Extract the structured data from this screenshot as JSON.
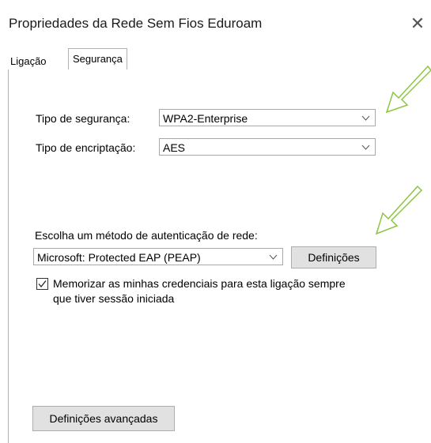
{
  "window": {
    "title": "Propriedades da Rede Sem Fios Eduroam",
    "close_glyph": "✕"
  },
  "tabs": [
    {
      "label": "Ligação",
      "active": false
    },
    {
      "label": "Segurança",
      "active": true
    }
  ],
  "security": {
    "type_label": "Tipo de segurança:",
    "type_value": "WPA2-Enterprise",
    "encryption_label": "Tipo de encriptação:",
    "encryption_value": "AES"
  },
  "auth": {
    "label": "Escolha um método de autenticação de rede:",
    "method_value": "Microsoft: Protected EAP (PEAP)",
    "settings_button": "Definições"
  },
  "remember": {
    "checked": true,
    "line1": "Memorizar as minhas credenciais para esta ligação sempre",
    "line2": "que tiver sessão iniciada"
  },
  "advanced_button": "Definições avançadas",
  "colors": {
    "annotation_arrow": "#8cc63f",
    "button_bg": "#e1e1e1",
    "border": "#a8a8a8"
  },
  "icons": {
    "close": "close-icon",
    "dropdown": "chevron-down-icon",
    "checkbox": "checkmark-icon",
    "annotation": "arrow-annotation-icon"
  }
}
